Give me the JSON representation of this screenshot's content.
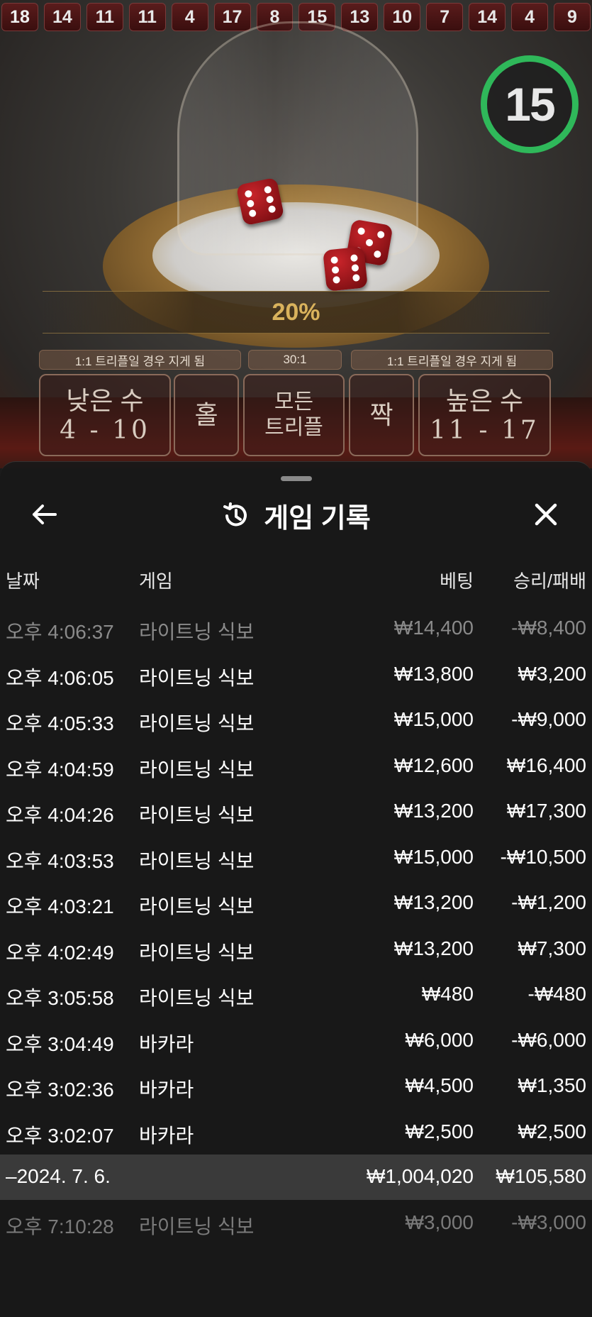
{
  "history_strip": [
    "18",
    "14",
    "11",
    "11",
    "4",
    "17",
    "8",
    "15",
    "13",
    "10",
    "7",
    "14",
    "4",
    "9"
  ],
  "multiplier": "20%",
  "timer": "15",
  "odds_labels": [
    "1:1 트리플일 경우 지게 됨",
    "30:1",
    "1:1 트리플일 경우 지게 됨"
  ],
  "bets": {
    "low": {
      "label": "낮은 수",
      "range": "4 - 10"
    },
    "odd": {
      "label": "홀"
    },
    "any_triple": {
      "label_1": "모든",
      "label_2": "트리플"
    },
    "even": {
      "label": "짝"
    },
    "high": {
      "label": "높은 수",
      "range": "11 - 17"
    }
  },
  "sheet": {
    "title": "게임 기록",
    "icons": {
      "back": "arrow-left-icon",
      "history": "history-icon",
      "close": "close-icon"
    }
  },
  "columns": {
    "date": "날짜",
    "game": "게임",
    "bet": "베팅",
    "winloss": "승리/패배"
  },
  "rows": [
    {
      "time": "오후 4:06:37",
      "game": "라이트닝 식보",
      "bet": "₩14,400",
      "win": "-₩8,400"
    },
    {
      "time": "오후 4:06:05",
      "game": "라이트닝 식보",
      "bet": "₩13,800",
      "win": "₩3,200"
    },
    {
      "time": "오후 4:05:33",
      "game": "라이트닝 식보",
      "bet": "₩15,000",
      "win": "-₩9,000"
    },
    {
      "time": "오후 4:04:59",
      "game": "라이트닝 식보",
      "bet": "₩12,600",
      "win": "₩16,400"
    },
    {
      "time": "오후 4:04:26",
      "game": "라이트닝 식보",
      "bet": "₩13,200",
      "win": "₩17,300"
    },
    {
      "time": "오후 4:03:53",
      "game": "라이트닝 식보",
      "bet": "₩15,000",
      "win": "-₩10,500"
    },
    {
      "time": "오후 4:03:21",
      "game": "라이트닝 식보",
      "bet": "₩13,200",
      "win": "-₩1,200"
    },
    {
      "time": "오후 4:02:49",
      "game": "라이트닝 식보",
      "bet": "₩13,200",
      "win": "₩7,300"
    },
    {
      "time": "오후 3:05:58",
      "game": "라이트닝 식보",
      "bet": "₩480",
      "win": "-₩480"
    },
    {
      "time": "오후 3:04:49",
      "game": "바카라",
      "bet": "₩6,000",
      "win": "-₩6,000"
    },
    {
      "time": "오후 3:02:36",
      "game": "바카라",
      "bet": "₩4,500",
      "win": "₩1,350"
    },
    {
      "time": "오후 3:02:07",
      "game": "바카라",
      "bet": "₩2,500",
      "win": "₩2,500"
    }
  ],
  "summary": {
    "date": "–2024. 7. 6.",
    "bet": "₩1,004,020",
    "win": "₩105,580"
  },
  "after_rows": [
    {
      "time": "오후 7:10:28",
      "game": "라이트닝 식보",
      "bet": "₩3,000",
      "win": "-₩3,000"
    }
  ]
}
